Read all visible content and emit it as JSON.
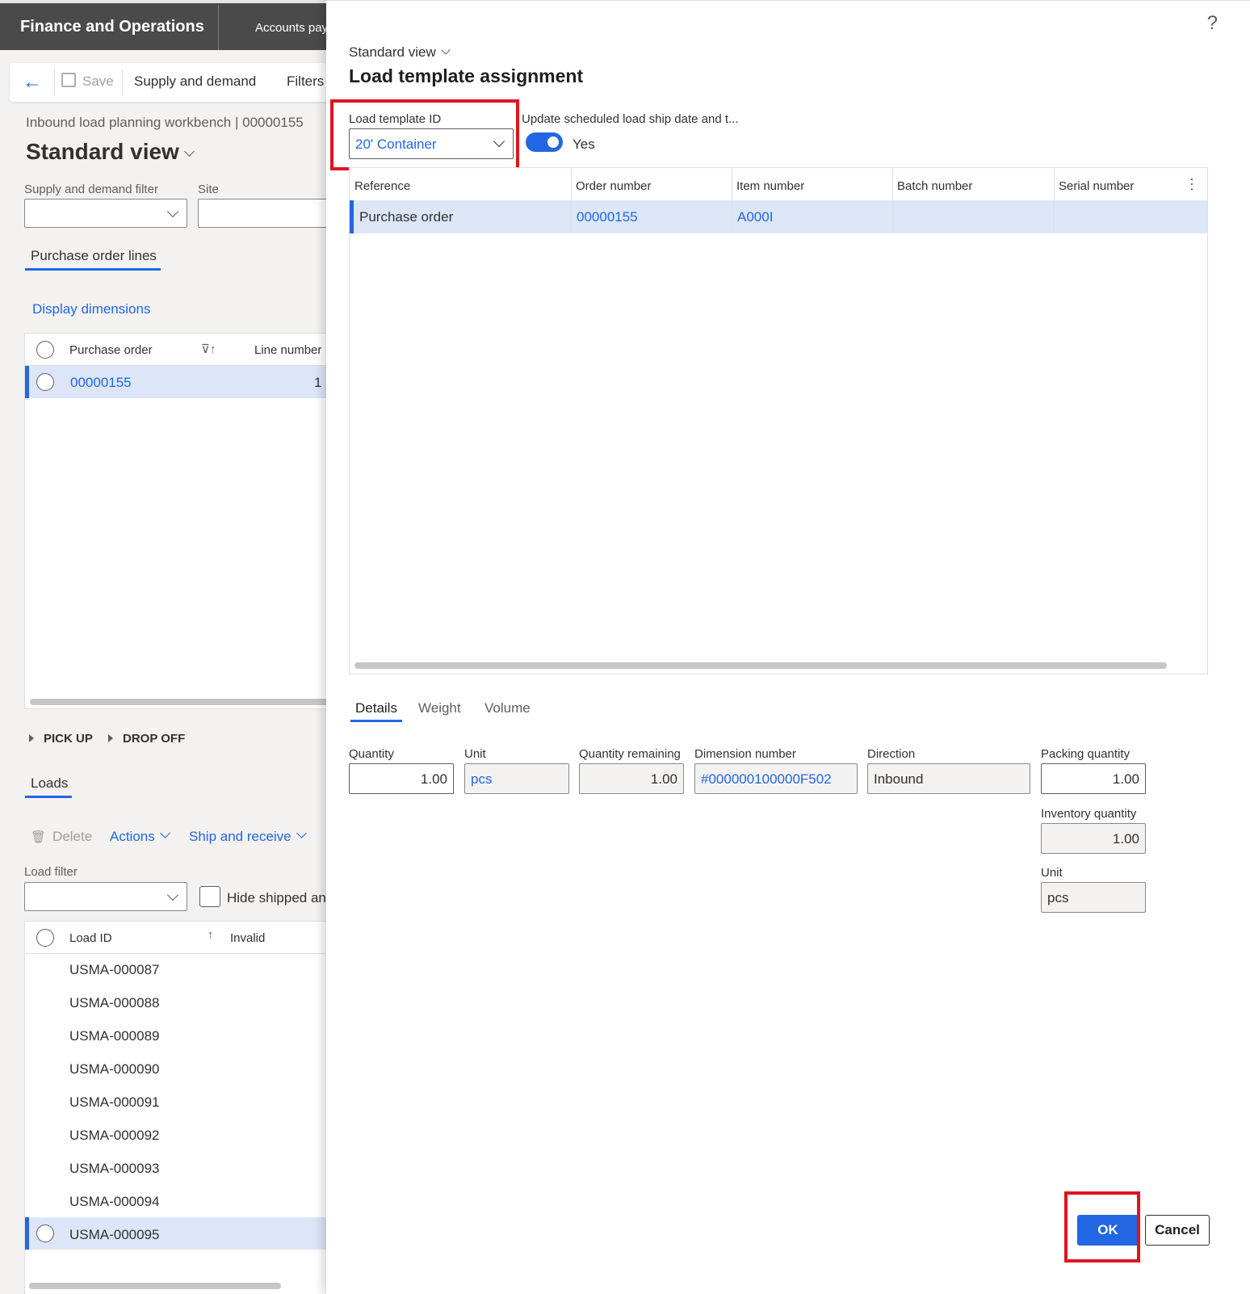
{
  "app": {
    "title": "Finance and Operations",
    "module": "Accounts payable"
  },
  "actionbar": {
    "save_label": "Save",
    "supply_demand_label": "Supply and demand",
    "filters_label": "Filters"
  },
  "workspace": {
    "breadcrumb": "Inbound load planning workbench  |  00000155",
    "view_title": "Standard view",
    "supply_demand_filter_label": "Supply and demand filter",
    "site_label": "Site",
    "po_lines_tab": "Purchase order lines",
    "display_dimensions": "Display dimensions",
    "po_grid": {
      "col_purchase_order": "Purchase order",
      "col_line_number": "Line number",
      "rows": [
        {
          "purchase_order": "00000155",
          "line_number": "1"
        }
      ]
    },
    "pick_up": "PICK UP",
    "drop_off": "DROP OFF",
    "loads_tab": "Loads",
    "loads_actions": {
      "delete": "Delete",
      "actions": "Actions",
      "ship_receive": "Ship and receive"
    },
    "load_filter_label": "Load filter",
    "hide_shipped_label": "Hide shipped and received",
    "loads_grid": {
      "col_load_id": "Load ID",
      "col_invalid": "Invalid",
      "rows": [
        "USMA-000087",
        "USMA-000088",
        "USMA-000089",
        "USMA-000090",
        "USMA-000091",
        "USMA-000092",
        "USMA-000093",
        "USMA-000094",
        "USMA-000095"
      ]
    }
  },
  "dialog": {
    "help": "?",
    "view_name": "Standard view",
    "title": "Load template assignment",
    "template_id_label": "Load template ID",
    "template_id_value": "20' Container",
    "update_date_label": "Update scheduled load ship date and t...",
    "update_date_value": "Yes",
    "grid": {
      "columns": [
        "Reference",
        "Order number",
        "Item number",
        "Batch number",
        "Serial number"
      ],
      "rows": [
        {
          "reference": "Purchase order",
          "order_number": "00000155",
          "item_number": "A000I",
          "batch_number": "",
          "serial_number": ""
        }
      ]
    },
    "tabs": [
      "Details",
      "Weight",
      "Volume"
    ],
    "details": {
      "quantity_label": "Quantity",
      "quantity_value": "1.00",
      "unit_label": "Unit",
      "unit_value": "pcs",
      "qty_remaining_label": "Quantity remaining",
      "qty_remaining_value": "1.00",
      "dimension_label": "Dimension number",
      "dimension_value": "#000000100000F502",
      "direction_label": "Direction",
      "direction_value": "Inbound",
      "packing_qty_label": "Packing quantity",
      "packing_qty_value": "1.00",
      "inventory_qty_label": "Inventory quantity",
      "inventory_qty_value": "1.00",
      "inv_unit_label": "Unit",
      "inv_unit_value": "pcs"
    },
    "ok_label": "OK",
    "cancel_label": "Cancel"
  },
  "colors": {
    "accent": "#2266e3",
    "highlight": "#e0141e",
    "topbar": "#4a4a4a"
  }
}
